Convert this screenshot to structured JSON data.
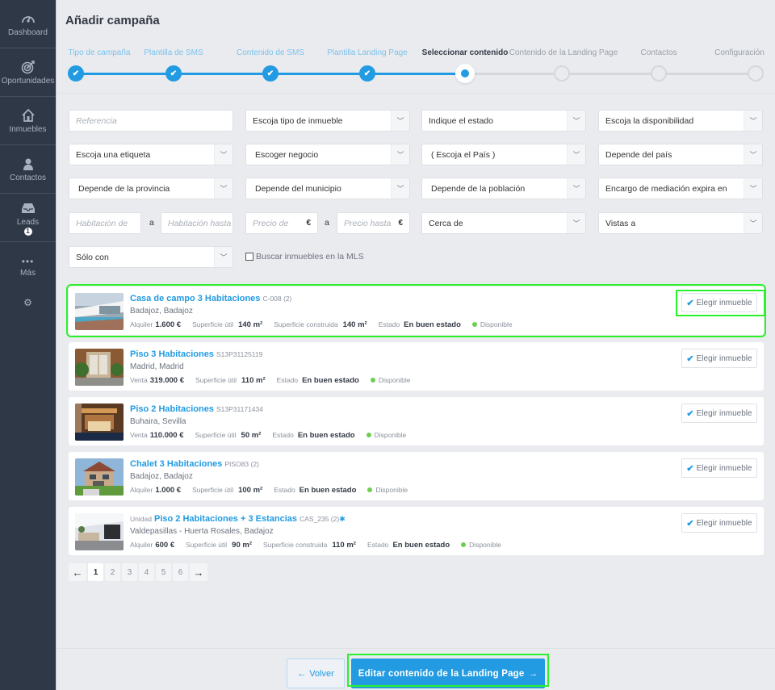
{
  "sidebar": {
    "items": [
      {
        "label": "Dashboard",
        "icon": "gauge-icon"
      },
      {
        "label": "Oportunidades",
        "icon": "target-icon"
      },
      {
        "label": "Inmuebles",
        "icon": "house-icon"
      },
      {
        "label": "Contactos",
        "icon": "person-icon"
      },
      {
        "label": "Leads",
        "icon": "inbox-icon",
        "badge": "1"
      },
      {
        "label": "Más",
        "icon": "ellipsis-icon"
      }
    ],
    "settings_icon": "gear-icon"
  },
  "header": {
    "title": "Añadir campaña"
  },
  "wizard": {
    "steps": [
      {
        "label": "Tipo de campaña",
        "state": "done"
      },
      {
        "label": "Plantilla de SMS",
        "state": "done"
      },
      {
        "label": "Contenido de SMS",
        "state": "done"
      },
      {
        "label": "Plantilla Landing Page",
        "state": "done"
      },
      {
        "label": "Seleccionar contenido",
        "state": "current"
      },
      {
        "label": "Contenido de la Landing Page",
        "state": "future"
      },
      {
        "label": "Contactos",
        "state": "future"
      },
      {
        "label": "Configuración",
        "state": "future"
      }
    ]
  },
  "filters": {
    "referencia_placeholder": "Referencia",
    "tipo_inmueble": "Escoja tipo de inmueble",
    "estado": "Indique el estado",
    "disponibilidad": "Escoja la disponibilidad",
    "etiqueta": "Escoja una etiqueta",
    "negocio": "Escoger negocio",
    "pais": "( Escoja el País )",
    "depende_pais": "Depende del país",
    "provincia": "Depende de la provincia",
    "municipio": "Depende del municipio",
    "poblacion": "Depende de la población",
    "encargo": "Encargo de mediación expira en",
    "habitacion_de_placeholder": "Habitación de",
    "habitacion_hasta_placeholder": "Habitación hasta",
    "range_sep": "a",
    "precio_de_placeholder": "Precio de",
    "precio_hasta_placeholder": "Precio hasta",
    "currency": "€",
    "cerca_de": "Cerca de",
    "vistas_a": "Vistas a",
    "solo_con": "Sólo con",
    "mls_checkbox_label": "Buscar inmuebles en la MLS",
    "mls_checked": false
  },
  "results": [
    {
      "prefix": "",
      "title": "Casa de campo 3 Habitaciones",
      "ref": "C-008 (2)",
      "location": "Badajoz, Badajoz",
      "price_label": "Alquiler",
      "price": "1.600 €",
      "util_label": "Superficie útil",
      "util": "140 m²",
      "built_label": "Superficie construida",
      "built": "140 m²",
      "estado_label": "Estado",
      "estado": "En buen estado",
      "status": "Disponible",
      "selected": true,
      "thumb": "modern-villa-pool"
    },
    {
      "prefix": "",
      "title": "Piso 3 Habitaciones",
      "ref": "S13P31125119",
      "location": "Madrid, Madrid",
      "price_label": "Venta",
      "price": "319.000 €",
      "util_label": "Superficie útil",
      "util": "110 m²",
      "estado_label": "Estado",
      "estado": "En buen estado",
      "status": "Disponible",
      "selected": false,
      "thumb": "entrance-plants"
    },
    {
      "prefix": "",
      "title": "Piso 2 Habitaciones",
      "ref": "S13P31171434",
      "location": "Buhaira, Sevilla",
      "price_label": "Venta",
      "price": "110.000 €",
      "util_label": "Superficie útil",
      "util": "50 m²",
      "estado_label": "Estado",
      "estado": "En buen estado",
      "status": "Disponible",
      "selected": false,
      "thumb": "wooden-bedroom"
    },
    {
      "prefix": "",
      "title": "Chalet 3 Habitaciones",
      "ref": "PISO83 (2)",
      "location": "Badajoz, Badajoz",
      "price_label": "Alquiler",
      "price": "1.000 €",
      "util_label": "Superficie útil",
      "util": "100 m²",
      "estado_label": "Estado",
      "estado": "En buen estado",
      "status": "Disponible",
      "selected": false,
      "thumb": "chalet-garden"
    },
    {
      "prefix": "Unidad",
      "title": "Piso 2 Habitaciones + 3 Estancias",
      "ref": "CAS_235 (2)",
      "star": "✱",
      "location": "Valdepasillas - Huerta Rosales, Badajoz",
      "price_label": "Alquiler",
      "price": "600 €",
      "util_label": "Superficie útil",
      "util": "90 m²",
      "built_label": "Superficie construida",
      "built": "110 m²",
      "estado_label": "Estado",
      "estado": "En buen estado",
      "status": "Disponible",
      "selected": false,
      "thumb": "living-room"
    }
  ],
  "pick_button_label": "Elegir inmueble",
  "pagination": {
    "prev": "🡐",
    "next": "🡒",
    "pages": [
      "1",
      "2",
      "3",
      "4",
      "5",
      "6"
    ],
    "current": "1"
  },
  "footer": {
    "back_label": "Volver",
    "next_label": "Editar contenido de la Landing Page"
  },
  "colors": {
    "accent": "#229be2",
    "sidebar": "#2f3847",
    "available": "#6ccf4f",
    "highlight": "#2bf12b"
  }
}
